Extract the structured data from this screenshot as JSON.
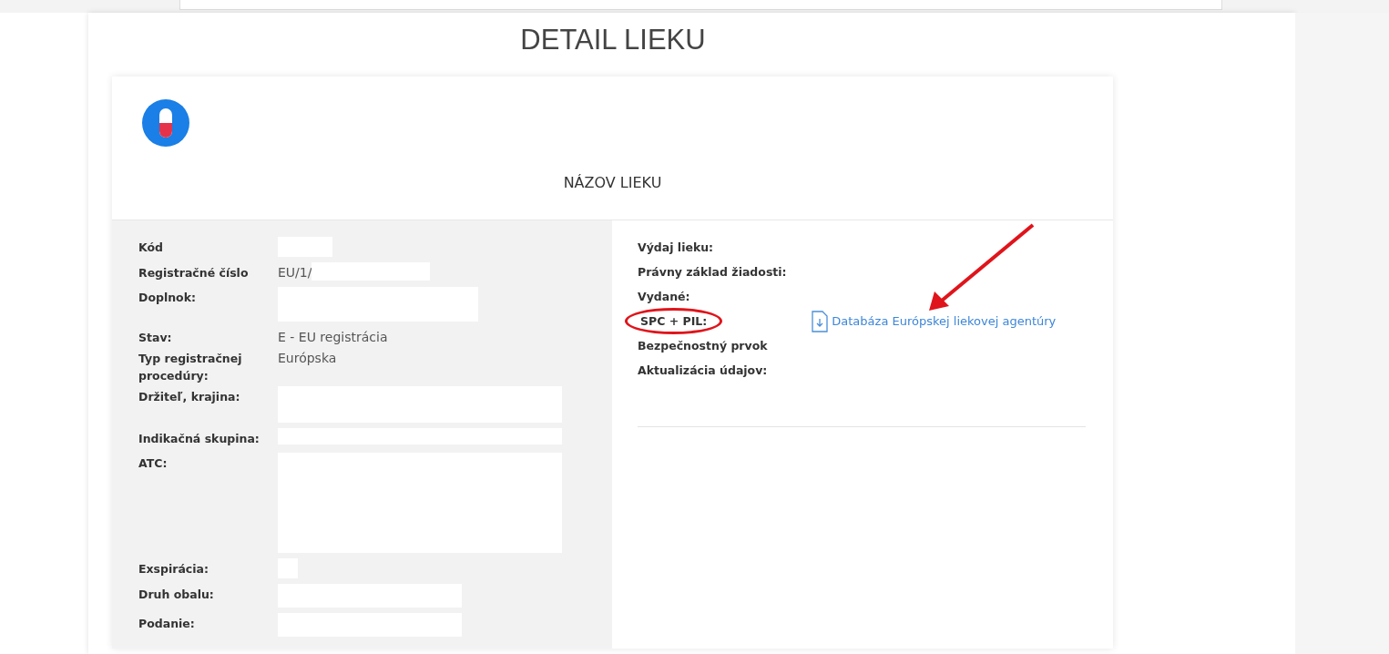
{
  "page_title": "DETAIL LIEKU",
  "drug": {
    "name": "NÁZOV LIEKU"
  },
  "details_left": [
    {
      "label": "Kód",
      "redacted": true
    },
    {
      "label": "Registračné číslo",
      "value": "EU/1/",
      "redacted": true
    },
    {
      "label": "Doplnok:",
      "redacted": true
    },
    {
      "label": "Stav:",
      "value": "E - EU registrácia",
      "redacted": false
    },
    {
      "label": "Typ registračnej procedúry:",
      "value": "Európska",
      "redacted": false
    },
    {
      "label": "Držiteľ, krajina:",
      "redacted": true
    },
    {
      "label": "Indikačná skupina:",
      "redacted": true
    },
    {
      "label": "ATC:",
      "redacted": true
    },
    {
      "label": "Exspirácia:",
      "redacted": true
    },
    {
      "label": "Druh obalu:",
      "redacted": true
    },
    {
      "label": "Podanie:",
      "redacted": true
    }
  ],
  "details_right": [
    {
      "label": "Výdaj lieku:",
      "circled": false
    },
    {
      "label": "Právny základ žiadosti:",
      "circled": false
    },
    {
      "label": "Vydané:",
      "circled": false
    },
    {
      "label": "SPC + PIL:",
      "circled": true,
      "link": "Databáza Európskej liekovej agentúry"
    },
    {
      "label": "Bezpečnostný prvok",
      "circled": false
    },
    {
      "label": "Aktualizácia údajov:",
      "circled": false
    }
  ],
  "arrow_annotation": true
}
